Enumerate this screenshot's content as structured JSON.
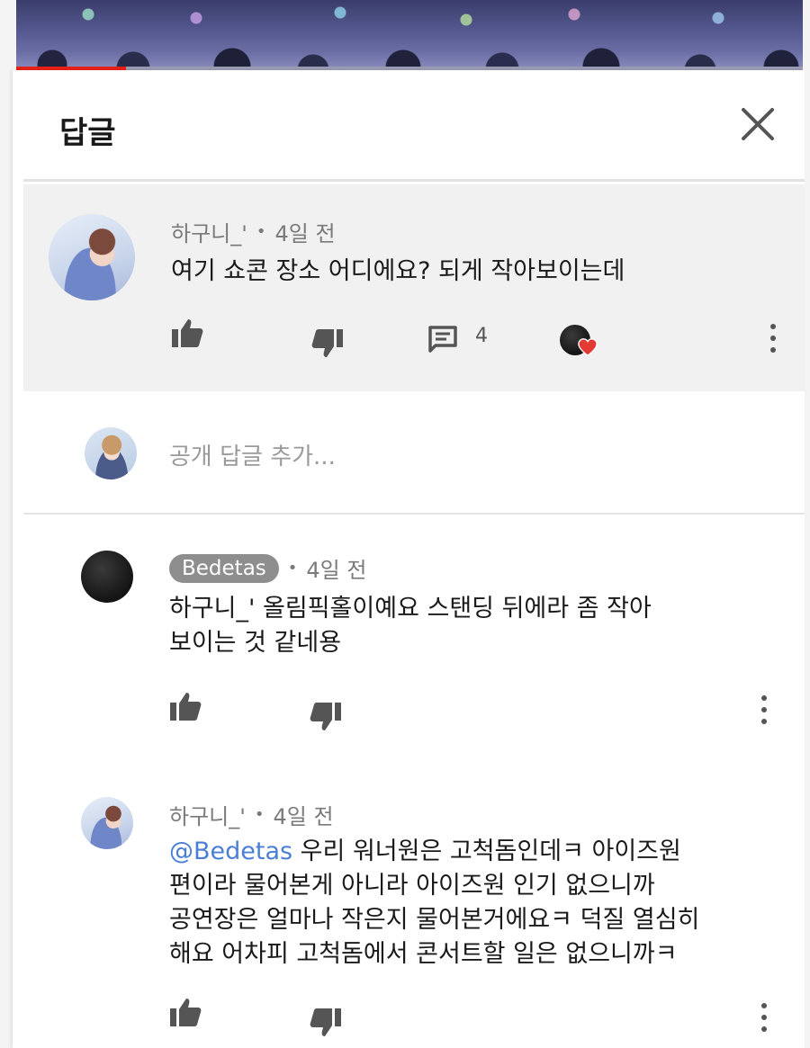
{
  "video": {
    "progress_fraction": 0.14
  },
  "panel": {
    "title": "답글",
    "close_icon": "close-icon"
  },
  "parent_comment": {
    "author": "하구니_'",
    "time": "4일 전",
    "text": "여기 쇼콘 장소 어디에요? 되게 작아보이는데",
    "reply_count": "4",
    "creator_heart": true
  },
  "reply_input": {
    "placeholder": "공개 답글 추가..."
  },
  "replies": [
    {
      "author": "Bedetas",
      "time": "4일 전",
      "lines": [
        "하구니_' 올림픽홀이예요 스탠딩 뒤에라 좀 작아",
        "보이는 것 같네용"
      ]
    },
    {
      "author": "하구니_'",
      "time": "4일 전",
      "mention": "@Bedetas",
      "lines": [
        " 우리 워너원은 고척돔인데ㅋ 아이즈원",
        "편이라 물어본게 아니라 아이즈원 인기 없으니까",
        "공연장은 얼마나 작은지 물어본거에요ㅋ 덕질 열심히",
        "해요 어차피 고척돔에서 콘서트할 일은 없으니까ㅋ"
      ]
    }
  ],
  "colors": {
    "accent": "#e62117",
    "mention": "#4a7fd6",
    "heart": "#e53935"
  }
}
